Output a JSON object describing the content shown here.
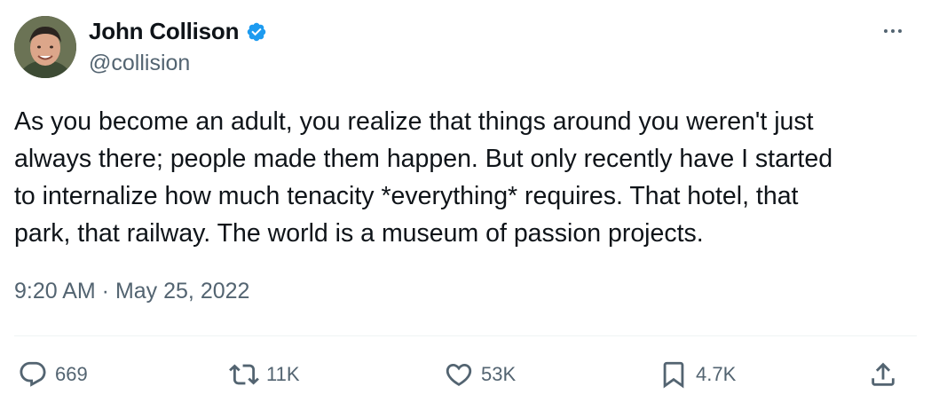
{
  "author": {
    "name": "John Collison",
    "handle": "@collision",
    "verified": true,
    "avatar_icon": "profile-photo"
  },
  "tweet": {
    "text": "As you become an adult, you realize that things around you weren't just\nalways there; people made them happen. But only recently have I started\nto internalize how much tenacity *everything* requires. That hotel, that\npark, that railway. The world is a museum of passion projects.",
    "timestamp": "9:20 AM · May 25, 2022"
  },
  "stats": {
    "replies": "669",
    "retweets": "11K",
    "likes": "53K",
    "bookmarks": "4.7K"
  },
  "icons": {
    "reply": "reply-icon",
    "retweet": "retweet-icon",
    "like": "heart-icon",
    "bookmark": "bookmark-icon",
    "share": "share-icon",
    "more": "more-icon",
    "verified": "verified-badge-icon"
  },
  "colors": {
    "text_primary": "#0f1419",
    "text_secondary": "#536471",
    "verified_blue": "#1d9bf0",
    "divider": "#eff3f4",
    "background": "#ffffff"
  }
}
